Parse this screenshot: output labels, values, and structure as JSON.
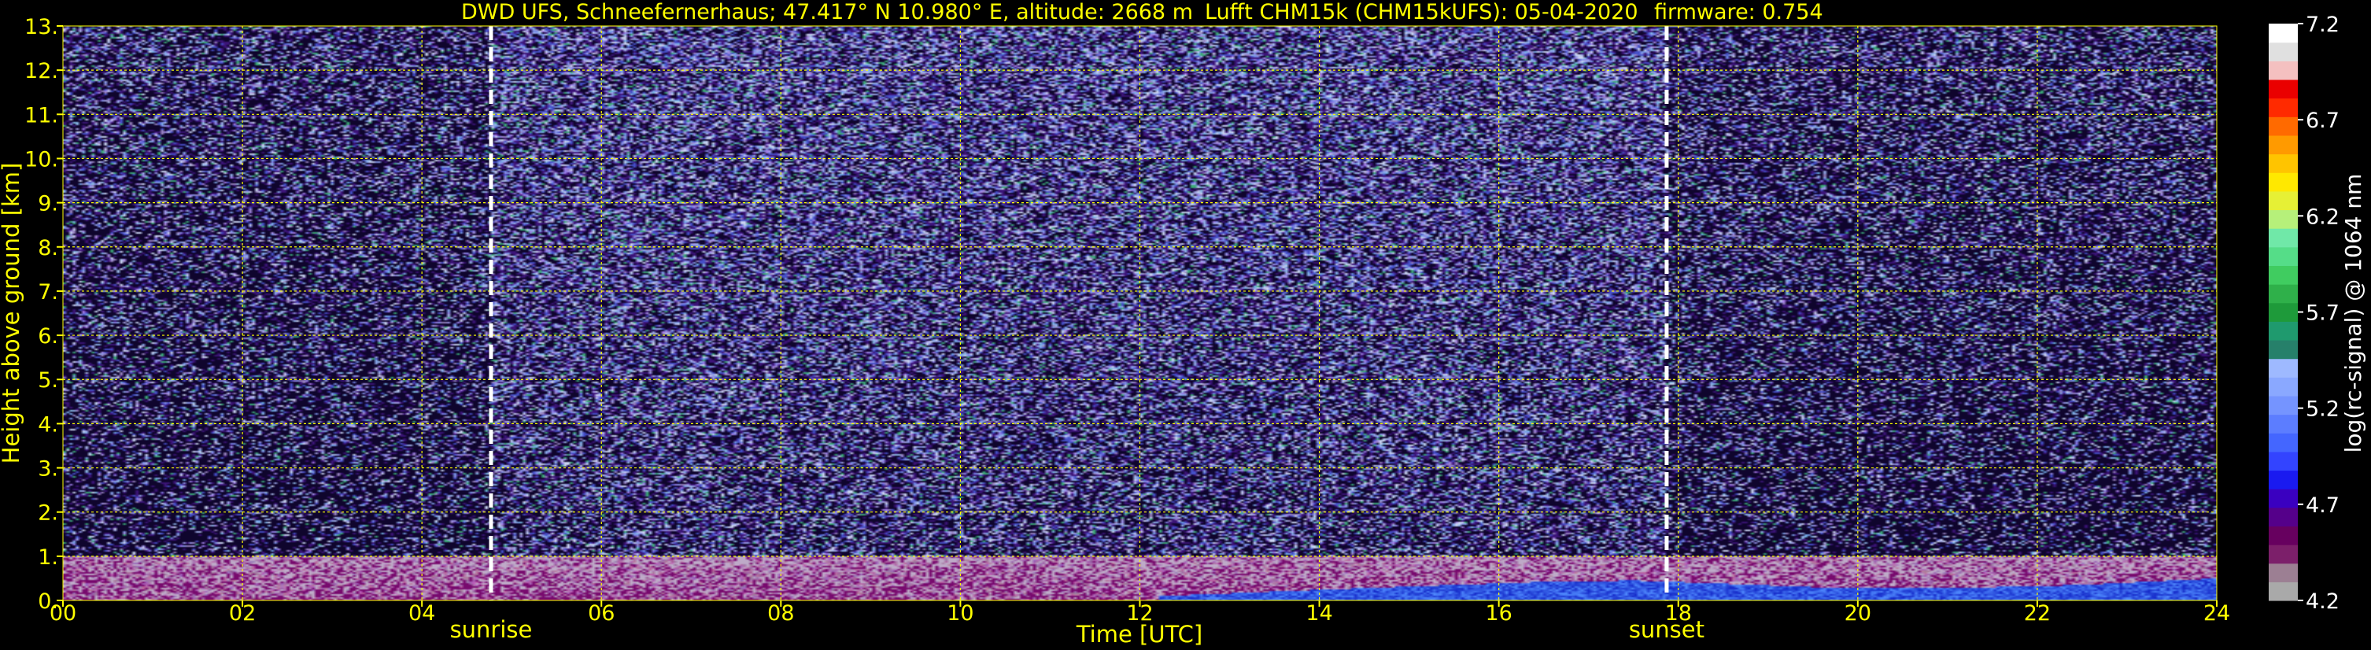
{
  "chart_data": {
    "type": "heatmap",
    "title_parts": [
      "DWD UFS, Schneefernerhaus; 47.417° N 10.980° E, altitude: 2668 m",
      "Lufft CHM15k (CHM15kUFS): 05-04-2020",
      "firmware: 0.754"
    ],
    "xlabel": "Time [UTC]",
    "ylabel": "Height above ground [km]",
    "colorbar_label": "log(rc-signal) @ 1064 nm",
    "xlim": [
      0,
      24
    ],
    "ylim": [
      0,
      13
    ],
    "x_ticks": [
      "00",
      "02",
      "04",
      "06",
      "08",
      "10",
      "12",
      "14",
      "16",
      "18",
      "20",
      "22",
      "24"
    ],
    "x_tick_values": [
      0,
      2,
      4,
      6,
      8,
      10,
      12,
      14,
      16,
      18,
      20,
      22,
      24
    ],
    "y_ticks": [
      "0.",
      "1.",
      "2.",
      "3.",
      "4.",
      "5.",
      "6.",
      "7.",
      "8.",
      "9.",
      "10.",
      "11.",
      "12.",
      "13."
    ],
    "y_tick_values": [
      0,
      1,
      2,
      3,
      4,
      5,
      6,
      7,
      8,
      9,
      10,
      11,
      12,
      13
    ],
    "colorbar_range": [
      4.2,
      7.2
    ],
    "colorbar_ticks": [
      "4.2",
      "4.7",
      "5.2",
      "5.7",
      "6.2",
      "6.7",
      "7.2"
    ],
    "colorbar_tick_values": [
      4.2,
      4.7,
      5.2,
      5.7,
      6.2,
      6.7,
      7.2
    ],
    "colorbar_colors": [
      "#a9a9a9",
      "#9c7f93",
      "#7c1f6a",
      "#67005f",
      "#55008a",
      "#3a00c0",
      "#1a1af0",
      "#3344ff",
      "#4466ff",
      "#5c7dff",
      "#7594ff",
      "#8aa8ff",
      "#9eb9ff",
      "#26806a",
      "#1f9a6e",
      "#1e9a3a",
      "#2fb04a",
      "#40cc60",
      "#55dd88",
      "#70e8a8",
      "#b6f07a",
      "#e6f035",
      "#ffe800",
      "#ffc400",
      "#ff9a00",
      "#ff6a00",
      "#ff2a00",
      "#ea0000",
      "#f4c0c0",
      "#e0e0e0",
      "#ffffff"
    ],
    "grid": true,
    "grid_color": "#ffff00",
    "markers": [
      {
        "label": "sunrise",
        "x": 4.77
      },
      {
        "label": "sunset",
        "x": 17.87
      }
    ],
    "aerosol_layer_top_km": 1.0,
    "boundary_layer_profile": {
      "description_of_values": "height in km of the enhanced (blue) signal band near ground",
      "x": [
        0,
        4,
        8,
        11.5,
        12.5,
        13.5,
        14.5,
        15.5,
        16.5,
        17.5,
        18.5,
        19.5,
        20.5,
        21.5,
        22.5,
        23.5,
        24
      ],
      "y": [
        0.05,
        0.05,
        0.05,
        0.05,
        0.12,
        0.2,
        0.28,
        0.35,
        0.42,
        0.45,
        0.38,
        0.3,
        0.28,
        0.3,
        0.35,
        0.45,
        0.5
      ]
    }
  }
}
